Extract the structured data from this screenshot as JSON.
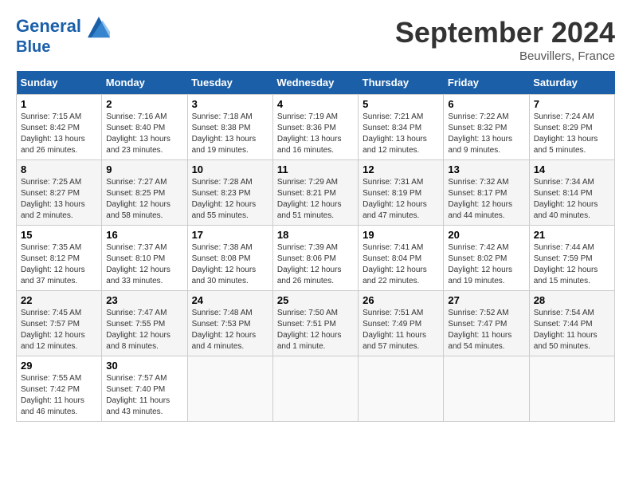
{
  "header": {
    "logo_line1": "General",
    "logo_line2": "Blue",
    "month_title": "September 2024",
    "location": "Beuvillers, France"
  },
  "days_of_week": [
    "Sunday",
    "Monday",
    "Tuesday",
    "Wednesday",
    "Thursday",
    "Friday",
    "Saturday"
  ],
  "weeks": [
    [
      {
        "day": "1",
        "info": "Sunrise: 7:15 AM\nSunset: 8:42 PM\nDaylight: 13 hours\nand 26 minutes."
      },
      {
        "day": "2",
        "info": "Sunrise: 7:16 AM\nSunset: 8:40 PM\nDaylight: 13 hours\nand 23 minutes."
      },
      {
        "day": "3",
        "info": "Sunrise: 7:18 AM\nSunset: 8:38 PM\nDaylight: 13 hours\nand 19 minutes."
      },
      {
        "day": "4",
        "info": "Sunrise: 7:19 AM\nSunset: 8:36 PM\nDaylight: 13 hours\nand 16 minutes."
      },
      {
        "day": "5",
        "info": "Sunrise: 7:21 AM\nSunset: 8:34 PM\nDaylight: 13 hours\nand 12 minutes."
      },
      {
        "day": "6",
        "info": "Sunrise: 7:22 AM\nSunset: 8:32 PM\nDaylight: 13 hours\nand 9 minutes."
      },
      {
        "day": "7",
        "info": "Sunrise: 7:24 AM\nSunset: 8:29 PM\nDaylight: 13 hours\nand 5 minutes."
      }
    ],
    [
      {
        "day": "8",
        "info": "Sunrise: 7:25 AM\nSunset: 8:27 PM\nDaylight: 13 hours\nand 2 minutes."
      },
      {
        "day": "9",
        "info": "Sunrise: 7:27 AM\nSunset: 8:25 PM\nDaylight: 12 hours\nand 58 minutes."
      },
      {
        "day": "10",
        "info": "Sunrise: 7:28 AM\nSunset: 8:23 PM\nDaylight: 12 hours\nand 55 minutes."
      },
      {
        "day": "11",
        "info": "Sunrise: 7:29 AM\nSunset: 8:21 PM\nDaylight: 12 hours\nand 51 minutes."
      },
      {
        "day": "12",
        "info": "Sunrise: 7:31 AM\nSunset: 8:19 PM\nDaylight: 12 hours\nand 47 minutes."
      },
      {
        "day": "13",
        "info": "Sunrise: 7:32 AM\nSunset: 8:17 PM\nDaylight: 12 hours\nand 44 minutes."
      },
      {
        "day": "14",
        "info": "Sunrise: 7:34 AM\nSunset: 8:14 PM\nDaylight: 12 hours\nand 40 minutes."
      }
    ],
    [
      {
        "day": "15",
        "info": "Sunrise: 7:35 AM\nSunset: 8:12 PM\nDaylight: 12 hours\nand 37 minutes."
      },
      {
        "day": "16",
        "info": "Sunrise: 7:37 AM\nSunset: 8:10 PM\nDaylight: 12 hours\nand 33 minutes."
      },
      {
        "day": "17",
        "info": "Sunrise: 7:38 AM\nSunset: 8:08 PM\nDaylight: 12 hours\nand 30 minutes."
      },
      {
        "day": "18",
        "info": "Sunrise: 7:39 AM\nSunset: 8:06 PM\nDaylight: 12 hours\nand 26 minutes."
      },
      {
        "day": "19",
        "info": "Sunrise: 7:41 AM\nSunset: 8:04 PM\nDaylight: 12 hours\nand 22 minutes."
      },
      {
        "day": "20",
        "info": "Sunrise: 7:42 AM\nSunset: 8:02 PM\nDaylight: 12 hours\nand 19 minutes."
      },
      {
        "day": "21",
        "info": "Sunrise: 7:44 AM\nSunset: 7:59 PM\nDaylight: 12 hours\nand 15 minutes."
      }
    ],
    [
      {
        "day": "22",
        "info": "Sunrise: 7:45 AM\nSunset: 7:57 PM\nDaylight: 12 hours\nand 12 minutes."
      },
      {
        "day": "23",
        "info": "Sunrise: 7:47 AM\nSunset: 7:55 PM\nDaylight: 12 hours\nand 8 minutes."
      },
      {
        "day": "24",
        "info": "Sunrise: 7:48 AM\nSunset: 7:53 PM\nDaylight: 12 hours\nand 4 minutes."
      },
      {
        "day": "25",
        "info": "Sunrise: 7:50 AM\nSunset: 7:51 PM\nDaylight: 12 hours\nand 1 minute."
      },
      {
        "day": "26",
        "info": "Sunrise: 7:51 AM\nSunset: 7:49 PM\nDaylight: 11 hours\nand 57 minutes."
      },
      {
        "day": "27",
        "info": "Sunrise: 7:52 AM\nSunset: 7:47 PM\nDaylight: 11 hours\nand 54 minutes."
      },
      {
        "day": "28",
        "info": "Sunrise: 7:54 AM\nSunset: 7:44 PM\nDaylight: 11 hours\nand 50 minutes."
      }
    ],
    [
      {
        "day": "29",
        "info": "Sunrise: 7:55 AM\nSunset: 7:42 PM\nDaylight: 11 hours\nand 46 minutes."
      },
      {
        "day": "30",
        "info": "Sunrise: 7:57 AM\nSunset: 7:40 PM\nDaylight: 11 hours\nand 43 minutes."
      },
      {
        "day": "",
        "info": ""
      },
      {
        "day": "",
        "info": ""
      },
      {
        "day": "",
        "info": ""
      },
      {
        "day": "",
        "info": ""
      },
      {
        "day": "",
        "info": ""
      }
    ]
  ]
}
